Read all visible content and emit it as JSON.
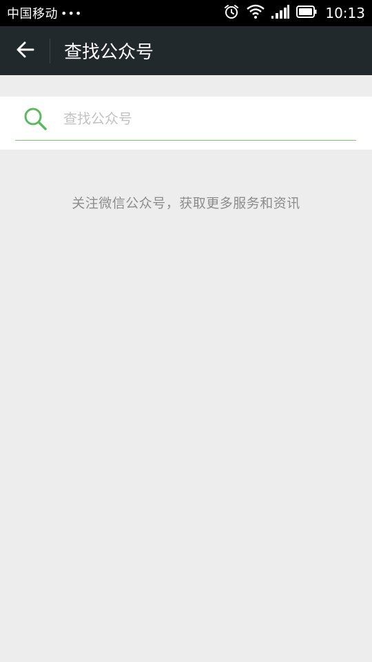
{
  "status_bar": {
    "carrier": "中国移动",
    "dots": "•••",
    "time": "10:13",
    "icons": [
      "alarm-icon",
      "wifi-icon",
      "signal-icon",
      "battery-icon"
    ]
  },
  "header": {
    "back_icon": "arrow-left-icon",
    "title": "查找公众号"
  },
  "search": {
    "icon": "search-icon",
    "placeholder": "查找公众号",
    "value": ""
  },
  "hint": {
    "text": "关注微信公众号，获取更多服务和资讯"
  },
  "colors": {
    "status_bar_bg": "#000000",
    "nav_bg": "#22292c",
    "page_bg": "#ededed",
    "accent_green": "#5cb85c",
    "underline_green": "#7bc86a",
    "hint_text": "#8c8c8c",
    "placeholder_text": "#c2c2c2"
  }
}
